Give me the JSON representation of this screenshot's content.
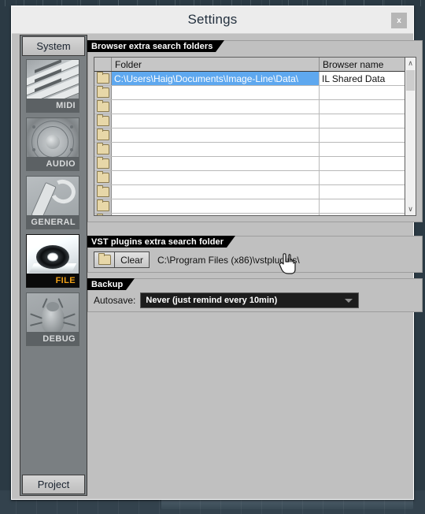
{
  "window": {
    "title": "Settings",
    "close_label": "x"
  },
  "sidebar": {
    "top_tab": {
      "label": "System"
    },
    "bottom_tab": {
      "label": "Project"
    },
    "items": [
      {
        "label": "MIDI",
        "icon": "midi-keyboard-icon",
        "selected": false
      },
      {
        "label": "AUDIO",
        "icon": "speaker-icon",
        "selected": false
      },
      {
        "label": "GENERAL",
        "icon": "wrench-icon",
        "selected": false
      },
      {
        "label": "FILE",
        "icon": "disk-drive-icon",
        "selected": true
      },
      {
        "label": "DEBUG",
        "icon": "bug-icon",
        "selected": false
      }
    ],
    "selected_color": "#f0a017"
  },
  "browser_section": {
    "title": "Browser extra search folders",
    "columns": [
      "",
      "Folder",
      "Browser name"
    ],
    "rows": [
      {
        "icon": "folder-icon",
        "folder": "C:\\Users\\Haig\\Documents\\Image-Line\\Data\\",
        "browser_name": "IL Shared Data",
        "selected": true
      },
      {
        "icon": "folder-icon",
        "folder": "",
        "browser_name": "",
        "selected": false
      },
      {
        "icon": "folder-icon",
        "folder": "",
        "browser_name": "",
        "selected": false
      },
      {
        "icon": "folder-icon",
        "folder": "",
        "browser_name": "",
        "selected": false
      },
      {
        "icon": "folder-icon",
        "folder": "",
        "browser_name": "",
        "selected": false
      },
      {
        "icon": "folder-icon",
        "folder": "",
        "browser_name": "",
        "selected": false
      },
      {
        "icon": "folder-icon",
        "folder": "",
        "browser_name": "",
        "selected": false
      },
      {
        "icon": "folder-icon",
        "folder": "",
        "browser_name": "",
        "selected": false
      },
      {
        "icon": "folder-icon",
        "folder": "",
        "browser_name": "",
        "selected": false
      },
      {
        "icon": "folder-icon",
        "folder": "",
        "browser_name": "",
        "selected": false
      },
      {
        "icon": "folder-icon",
        "folder": "",
        "browser_name": "",
        "selected": false
      }
    ],
    "scrollbar": {
      "up_glyph": "∧",
      "down_glyph": "∨"
    },
    "selection_color": "#5ea8ef"
  },
  "vst_section": {
    "title": "VST plugins extra search folder",
    "folder_button_icon": "folder-icon",
    "clear_label": "Clear",
    "path": "C:\\Program Files (x86)\\vstplugins\\"
  },
  "backup_section": {
    "title": "Backup",
    "autosave_label": "Autosave:",
    "autosave_value": "Never (just remind every 10min)",
    "dropdown_icon": "chevron-down-icon"
  },
  "cursor": {
    "icon": "hand-pointer-cursor"
  }
}
